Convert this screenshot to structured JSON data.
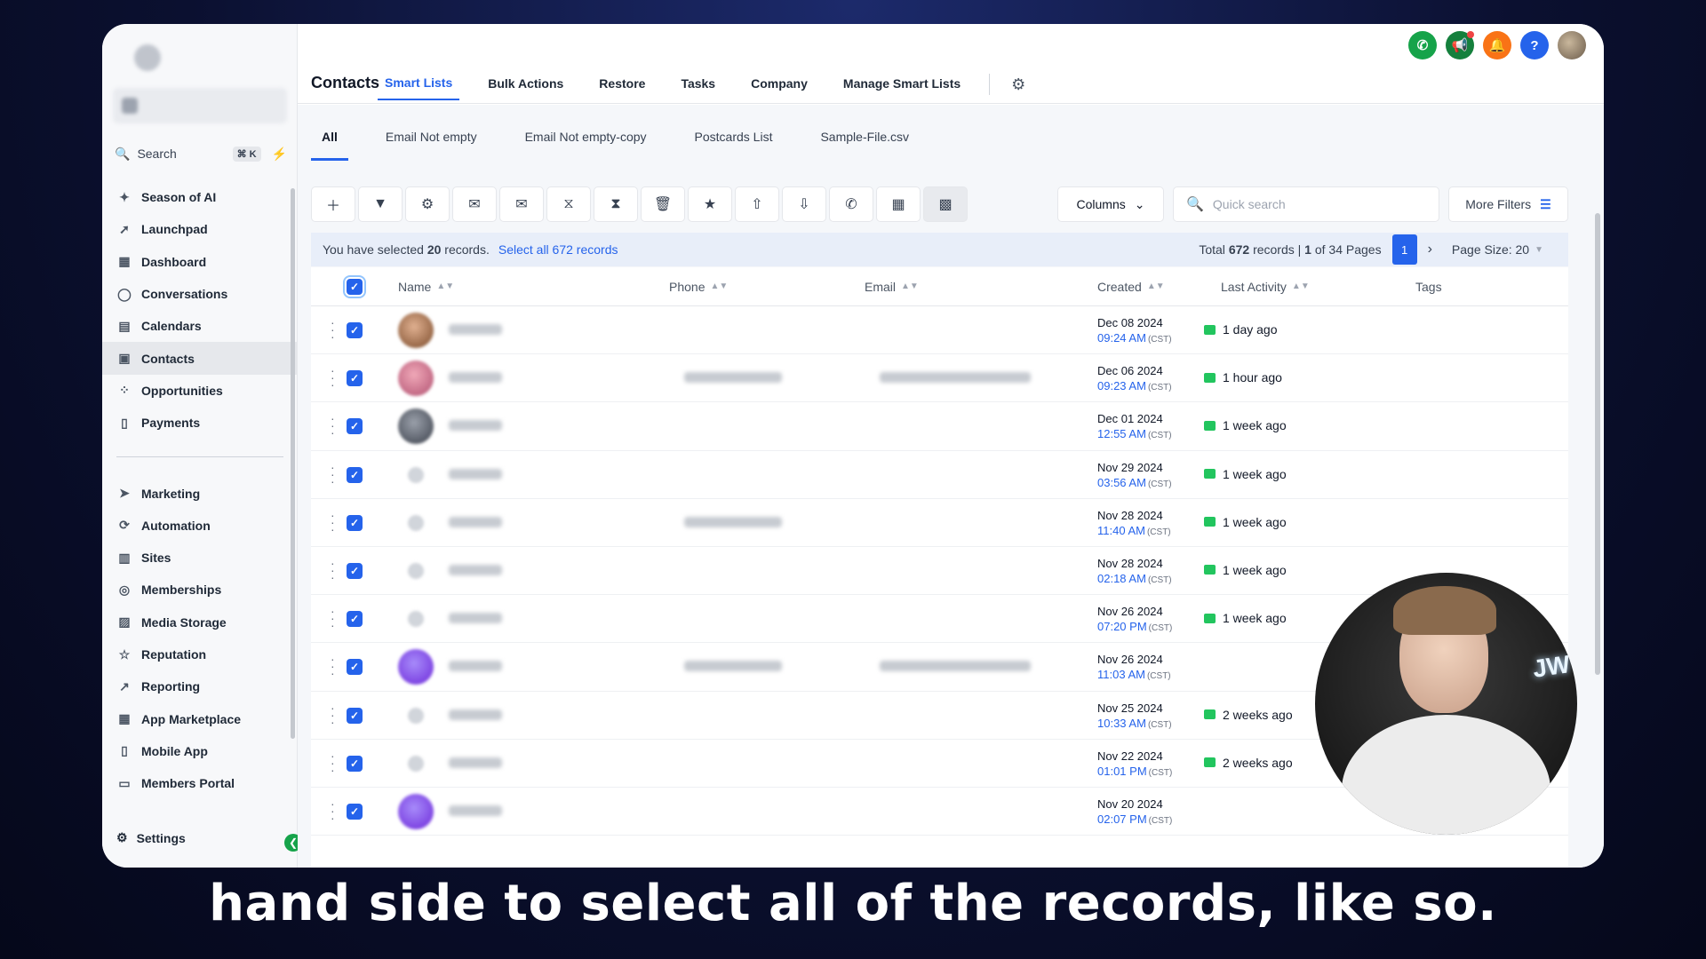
{
  "sidebar": {
    "search_label": "Search",
    "search_shortcut": "⌘ K",
    "nav_top": [
      {
        "label": "Season of AI",
        "icon": "sparkle-icon"
      },
      {
        "label": "Launchpad",
        "icon": "rocket-icon"
      },
      {
        "label": "Dashboard",
        "icon": "dashboard-icon"
      },
      {
        "label": "Conversations",
        "icon": "chat-icon"
      },
      {
        "label": "Calendars",
        "icon": "calendar-icon"
      },
      {
        "label": "Contacts",
        "icon": "contacts-icon",
        "active": true
      },
      {
        "label": "Opportunities",
        "icon": "opportunities-icon"
      },
      {
        "label": "Payments",
        "icon": "payments-icon"
      }
    ],
    "nav_bottom": [
      {
        "label": "Marketing",
        "icon": "send-icon"
      },
      {
        "label": "Automation",
        "icon": "automation-icon"
      },
      {
        "label": "Sites",
        "icon": "sites-icon"
      },
      {
        "label": "Memberships",
        "icon": "membership-icon"
      },
      {
        "label": "Media Storage",
        "icon": "image-icon"
      },
      {
        "label": "Reputation",
        "icon": "star-icon"
      },
      {
        "label": "Reporting",
        "icon": "chart-line-icon"
      },
      {
        "label": "App Marketplace",
        "icon": "grid-icon"
      },
      {
        "label": "Mobile App",
        "icon": "mobile-icon"
      },
      {
        "label": "Members Portal",
        "icon": "monitor-icon"
      }
    ],
    "settings_label": "Settings"
  },
  "header": {
    "title": "Contacts",
    "tabs": [
      "Smart Lists",
      "Bulk Actions",
      "Restore",
      "Tasks",
      "Company",
      "Manage Smart Lists"
    ],
    "active_tab": "Smart Lists"
  },
  "sub_tabs": [
    "All",
    "Email Not empty",
    "Email Not empty-copy",
    "Postcards List",
    "Sample-File.csv"
  ],
  "toolbar": {
    "columns_label": "Columns",
    "search_placeholder": "Quick search",
    "more_filters_label": "More Filters"
  },
  "selection": {
    "prefix": "You have selected",
    "count": "20",
    "suffix": "records.",
    "select_all_link": "Select all 672 records"
  },
  "pagination": {
    "total_prefix": "Total",
    "total": "672",
    "total_suffix": "records |",
    "page": "1",
    "pages_text": "of 34 Pages",
    "current_page": "1",
    "page_size_label": "Page Size: 20"
  },
  "table": {
    "columns": [
      "Name",
      "Phone",
      "Email",
      "Created",
      "Last Activity",
      "Tags"
    ],
    "rows": [
      {
        "date": "Dec 08 2024",
        "time": "09:24 AM",
        "tz": "(CST)",
        "activity": "1 day ago",
        "avatar": "photo1"
      },
      {
        "date": "Dec 06 2024",
        "time": "09:23 AM",
        "tz": "(CST)",
        "activity": "1 hour ago",
        "avatar": "photo2",
        "phone": true,
        "email": true
      },
      {
        "date": "Dec 01 2024",
        "time": "12:55 AM",
        "tz": "(CST)",
        "activity": "1 week ago",
        "avatar": "photo3"
      },
      {
        "date": "Nov 29 2024",
        "time": "03:56 AM",
        "tz": "(CST)",
        "activity": "1 week ago",
        "avatar": "small"
      },
      {
        "date": "Nov 28 2024",
        "time": "11:40 AM",
        "tz": "(CST)",
        "activity": "1 week ago",
        "avatar": "small",
        "phone": true
      },
      {
        "date": "Nov 28 2024",
        "time": "02:18 AM",
        "tz": "(CST)",
        "activity": "1 week ago",
        "avatar": "small"
      },
      {
        "date": "Nov 26 2024",
        "time": "07:20 PM",
        "tz": "(CST)",
        "activity": "1 week ago",
        "avatar": "small"
      },
      {
        "date": "Nov 26 2024",
        "time": "11:03 AM",
        "tz": "(CST)",
        "activity": "",
        "avatar": "purple",
        "phone": true,
        "email": true
      },
      {
        "date": "Nov 25 2024",
        "time": "10:33 AM",
        "tz": "(CST)",
        "activity": "2 weeks ago",
        "avatar": "small"
      },
      {
        "date": "Nov 22 2024",
        "time": "01:01 PM",
        "tz": "(CST)",
        "activity": "2 weeks ago",
        "avatar": "small"
      },
      {
        "date": "Nov 20 2024",
        "time": "02:07 PM",
        "tz": "(CST)",
        "activity": "",
        "avatar": "purple"
      }
    ]
  },
  "caption": "hand side to select all of the records, like so.",
  "colors": {
    "accent": "#2563eb",
    "success": "#16a34a",
    "warning": "#f97316"
  }
}
